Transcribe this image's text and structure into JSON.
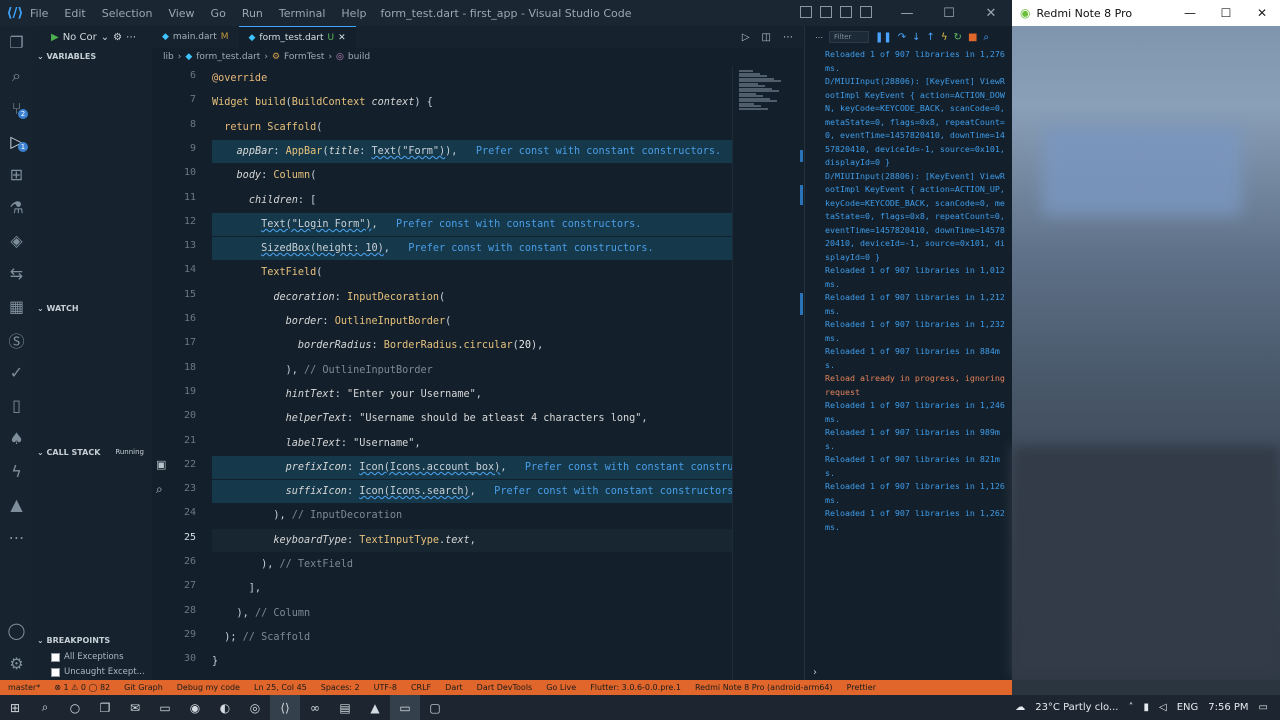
{
  "titlebar": {
    "menu": [
      "File",
      "Edit",
      "Selection",
      "View",
      "Go",
      "Run",
      "Terminal",
      "Help"
    ],
    "window_title": "form_test.dart - first_app - Visual Studio Code"
  },
  "sidebar": {
    "debug_config": "No Cor",
    "sections": {
      "variables": "VARIABLES",
      "watch": "WATCH",
      "call_stack": "CALL STACK",
      "call_stack_status": "Running",
      "breakpoints": "BREAKPOINTS"
    },
    "breakpoints": [
      "All Exceptions",
      "Uncaught Except..."
    ]
  },
  "tabs": [
    {
      "name": "main.dart",
      "status": "M"
    },
    {
      "name": "form_test.dart",
      "status": "U"
    }
  ],
  "breadcrumb": [
    "lib",
    "form_test.dart",
    "FormTest",
    "build"
  ],
  "editor": {
    "current_line": 25,
    "lines": [
      {
        "n": "6",
        "parts": [
          [
            "kw",
            "@override"
          ]
        ]
      },
      {
        "n": "7",
        "parts": [
          [
            "ty",
            "Widget "
          ],
          [
            "fn",
            "build"
          ],
          [
            "",
            "("
          ],
          [
            "ty",
            "BuildContext "
          ],
          [
            "pm",
            "context"
          ],
          [
            "",
            ") {"
          ]
        ]
      },
      {
        "n": "8",
        "parts": [
          [
            "",
            "  "
          ],
          [
            "kw",
            "return "
          ],
          [
            "fn",
            "Scaffold"
          ],
          [
            "",
            "("
          ]
        ]
      },
      {
        "n": "9",
        "hl": true,
        "parts": [
          [
            "",
            "    "
          ],
          [
            "pm",
            "appBar"
          ],
          [
            "",
            ": "
          ],
          [
            "fn",
            "AppBar"
          ],
          [
            "",
            "("
          ],
          [
            "pm",
            "title"
          ],
          [
            "",
            ": "
          ],
          [
            "sq",
            "Text(\"Form\")"
          ],
          [
            "",
            "),"
          ],
          [
            "hint",
            "   Prefer const with constant constructors."
          ]
        ]
      },
      {
        "n": "10",
        "parts": [
          [
            "",
            "    "
          ],
          [
            "pm",
            "body"
          ],
          [
            "",
            ": "
          ],
          [
            "fn",
            "Column"
          ],
          [
            "",
            "("
          ]
        ]
      },
      {
        "n": "11",
        "parts": [
          [
            "",
            "      "
          ],
          [
            "pm",
            "children"
          ],
          [
            "",
            ": ["
          ]
        ]
      },
      {
        "n": "12",
        "hl": true,
        "parts": [
          [
            "",
            "        "
          ],
          [
            "sq",
            "Text(\"Login Form\")"
          ],
          [
            "",
            ","
          ],
          [
            "hint",
            "   Prefer const with constant constructors."
          ]
        ]
      },
      {
        "n": "13",
        "hl": true,
        "parts": [
          [
            "",
            "        "
          ],
          [
            "sq",
            "SizedBox(height: 10)"
          ],
          [
            "",
            ","
          ],
          [
            "hint",
            "   Prefer const with constant constructors."
          ]
        ]
      },
      {
        "n": "14",
        "parts": [
          [
            "",
            "        "
          ],
          [
            "fn",
            "TextField"
          ],
          [
            "",
            "("
          ]
        ]
      },
      {
        "n": "15",
        "parts": [
          [
            "",
            "          "
          ],
          [
            "pm",
            "decoration"
          ],
          [
            "",
            ": "
          ],
          [
            "fn",
            "InputDecoration"
          ],
          [
            "",
            "("
          ]
        ]
      },
      {
        "n": "16",
        "parts": [
          [
            "",
            "            "
          ],
          [
            "pm",
            "border"
          ],
          [
            "",
            ": "
          ],
          [
            "fn",
            "OutlineInputBorder"
          ],
          [
            "",
            "("
          ]
        ]
      },
      {
        "n": "17",
        "parts": [
          [
            "",
            "              "
          ],
          [
            "pm",
            "borderRadius"
          ],
          [
            "",
            ": "
          ],
          [
            "ty",
            "BorderRadius"
          ],
          [
            "",
            "."
          ],
          [
            "fn",
            "circular"
          ],
          [
            "",
            "("
          ],
          [
            "nm",
            "20"
          ],
          [
            "",
            "),"
          ]
        ]
      },
      {
        "n": "18",
        "parts": [
          [
            "",
            "            ), "
          ],
          [
            "cm",
            "// OutlineInputBorder"
          ]
        ]
      },
      {
        "n": "19",
        "parts": [
          [
            "",
            "            "
          ],
          [
            "pm",
            "hintText"
          ],
          [
            "",
            ": "
          ],
          [
            "st",
            "\"Enter your Username\""
          ],
          [
            "",
            ","
          ]
        ]
      },
      {
        "n": "20",
        "parts": [
          [
            "",
            "            "
          ],
          [
            "pm",
            "helperText"
          ],
          [
            "",
            ": "
          ],
          [
            "st",
            "\"Username should be atleast 4 characters long\""
          ],
          [
            "",
            ","
          ]
        ]
      },
      {
        "n": "21",
        "parts": [
          [
            "",
            "            "
          ],
          [
            "pm",
            "labelText"
          ],
          [
            "",
            ": "
          ],
          [
            "st",
            "\"Username\""
          ],
          [
            "",
            ","
          ]
        ]
      },
      {
        "n": "22",
        "hl": true,
        "parts": [
          [
            "",
            "            "
          ],
          [
            "pm",
            "prefixIcon"
          ],
          [
            "",
            ": "
          ],
          [
            "sq",
            "Icon(Icons.account_box)"
          ],
          [
            "",
            ","
          ],
          [
            "hint",
            "   Prefer const with constant constructors."
          ]
        ]
      },
      {
        "n": "23",
        "hl": true,
        "parts": [
          [
            "",
            "            "
          ],
          [
            "pm",
            "suffixIcon"
          ],
          [
            "",
            ": "
          ],
          [
            "sq",
            "Icon(Icons.search)"
          ],
          [
            "",
            ","
          ],
          [
            "hint",
            "   Prefer const with constant constructors."
          ]
        ]
      },
      {
        "n": "24",
        "parts": [
          [
            "",
            "          ), "
          ],
          [
            "cm",
            "// InputDecoration"
          ]
        ]
      },
      {
        "n": "25",
        "cur": true,
        "parts": [
          [
            "",
            "          "
          ],
          [
            "pm",
            "keyboardType"
          ],
          [
            "",
            ": "
          ],
          [
            "ty",
            "TextInputType"
          ],
          [
            "",
            "."
          ],
          [
            "pm",
            "text"
          ],
          [
            "",
            ","
          ]
        ]
      },
      {
        "n": "26",
        "parts": [
          [
            "",
            "        ), "
          ],
          [
            "cm",
            "// TextField"
          ]
        ]
      },
      {
        "n": "27",
        "parts": [
          [
            "",
            "      ],"
          ]
        ]
      },
      {
        "n": "28",
        "parts": [
          [
            "",
            "    ), "
          ],
          [
            "cm",
            "// Column"
          ]
        ]
      },
      {
        "n": "29",
        "parts": [
          [
            "",
            "  ); "
          ],
          [
            "cm",
            "// Scaffold"
          ]
        ]
      },
      {
        "n": "30",
        "parts": [
          [
            "",
            "}"
          ]
        ]
      }
    ]
  },
  "debug_console": {
    "filter_placeholder": "Filter",
    "output": [
      {
        "t": "Reloaded 1 of 907 libraries in 1,276ms."
      },
      {
        "t": "D/MIUIInput(28806): [KeyEvent] ViewRootImpl KeyEvent { action=ACTION_DOWN, keyCode=KEYCODE_BACK, scanCode=0, metaState=0, flags=0x8, repeatCount=0, eventTime=1457820410, downTime=1457820410, deviceId=-1, source=0x101, displayId=0 }"
      },
      {
        "t": "D/MIUIInput(28806): [KeyEvent] ViewRootImpl KeyEvent { action=ACTION_UP, keyCode=KEYCODE_BACK, scanCode=0, metaState=0, flags=0x8, repeatCount=0, eventTime=1457820410, downTime=1457820410, deviceId=-1, source=0x101, displayId=0 }"
      },
      {
        "t": "Reloaded 1 of 907 libraries in 1,012ms."
      },
      {
        "t": "Reloaded 1 of 907 libraries in 1,212ms."
      },
      {
        "t": "Reloaded 1 of 907 libraries in 1,232ms."
      },
      {
        "t": "Reloaded 1 of 907 libraries in 884ms."
      },
      {
        "t": "Reload already in progress, ignoring request",
        "warn": true
      },
      {
        "t": "Reloaded 1 of 907 libraries in 1,246ms."
      },
      {
        "t": "Reloaded 1 of 907 libraries in 989ms."
      },
      {
        "t": "Reloaded 1 of 907 libraries in 821ms."
      },
      {
        "t": "Reloaded 1 of 907 libraries in 1,126ms."
      },
      {
        "t": "Reloaded 1 of 907 libraries in 1,262ms."
      }
    ]
  },
  "phone": {
    "title": "Redmi Note 8 Pro"
  },
  "statusbar": {
    "items": [
      "master*",
      "⊗ 1 ⚠ 0 ◯ 82",
      "Git Graph",
      "Debug my code",
      "Ln 25, Col 45",
      "Spaces: 2",
      "UTF-8",
      "CRLF",
      "Dart",
      "Dart DevTools",
      "Go Live",
      "Flutter: 3.0.6-0.0.pre.1",
      "Redmi Note 8 Pro (android-arm64)",
      "Prettier"
    ]
  },
  "taskbar": {
    "weather": "23°C  Partly clo...",
    "lang": "ENG",
    "time": "7:56 PM"
  },
  "colors": {
    "accent": "#e1662b",
    "hint": "#4a9ee8"
  }
}
